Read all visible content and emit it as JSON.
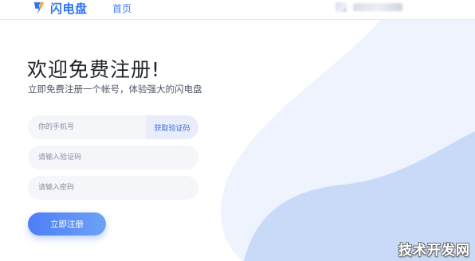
{
  "header": {
    "logo_text": "闪电盘",
    "logo_icon": "lightning-bolt",
    "nav_home": "首页",
    "brand_color": "#2f72f0"
  },
  "main": {
    "title": "欢迎免费注册!",
    "subtitle": "立即免费注册一个帐号，体验强大的闪电盘"
  },
  "form": {
    "phone_placeholder": "你的手机号",
    "get_code_label": "获取验证码",
    "code_placeholder": "请输入验证码",
    "password_placeholder": "请输入密码",
    "submit_label": "立即注册"
  },
  "watermark": "技术开发网",
  "colors": {
    "accent": "#4d7ef6",
    "accent_light": "#6da2f7",
    "deco_light": "#eef3fd",
    "deco_mid": "#c7d8f8",
    "input_bg": "#f5f6fa"
  }
}
